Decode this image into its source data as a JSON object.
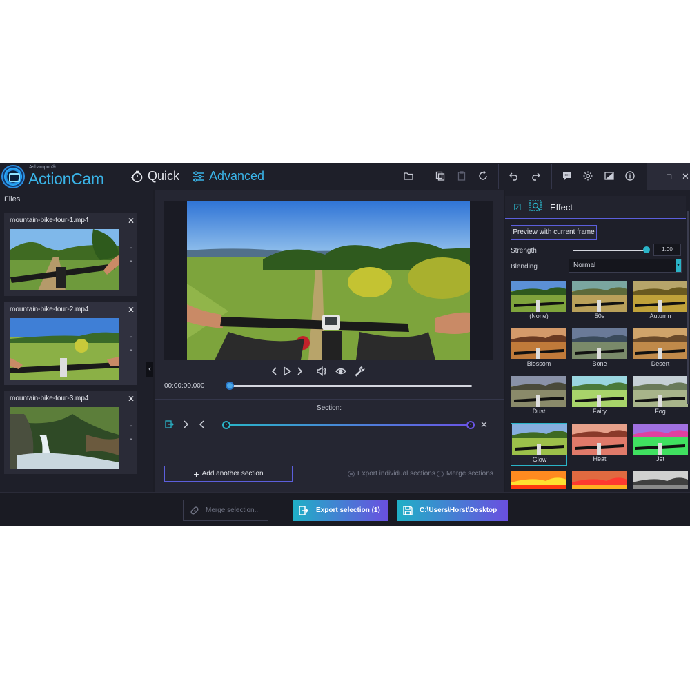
{
  "app": {
    "brand_small": "Ashampoo®",
    "brand": "ActionCam"
  },
  "modes": [
    {
      "label": "Quick",
      "icon": "stopwatch-icon"
    },
    {
      "label": "Advanced",
      "icon": "sliders-icon"
    }
  ],
  "colors": {
    "accent": "#2ab4c8",
    "accent2": "#6a4fe0",
    "bg": "#1c1d26"
  },
  "files": {
    "label": "Files",
    "items": [
      {
        "name": "mountain-bike-tour-1.mp4"
      },
      {
        "name": "mountain-bike-tour-2.mp4"
      },
      {
        "name": "mountain-bike-tour-3.mp4"
      }
    ]
  },
  "player": {
    "time": "00:00:00.000",
    "position": 0.0
  },
  "section": {
    "label": "Section:",
    "add_label": "Add another section",
    "export_individual": "Export individual sections",
    "merge_sections": "Merge sections"
  },
  "effect": {
    "title": "Effect",
    "preview_label": "Preview with current frame",
    "strength_label": "Strength",
    "strength_value": "1.00",
    "strength_level": 1.0,
    "blending_label": "Blending",
    "blending_value": "Normal",
    "items": [
      {
        "label": "(None)"
      },
      {
        "label": "50s"
      },
      {
        "label": "Autumn"
      },
      {
        "label": "Blossom"
      },
      {
        "label": "Bone"
      },
      {
        "label": "Desert"
      },
      {
        "label": "Dust"
      },
      {
        "label": "Fairy"
      },
      {
        "label": "Fog"
      },
      {
        "label": "Glow"
      },
      {
        "label": "Heat"
      },
      {
        "label": "Jet"
      },
      {
        "label": ""
      },
      {
        "label": ""
      },
      {
        "label": ""
      }
    ],
    "selected": "Glow"
  },
  "bottom": {
    "merge_label": "Merge selection...",
    "export_label": "Export selection (1)",
    "path_label": "C:\\Users\\Horst\\Desktop"
  }
}
